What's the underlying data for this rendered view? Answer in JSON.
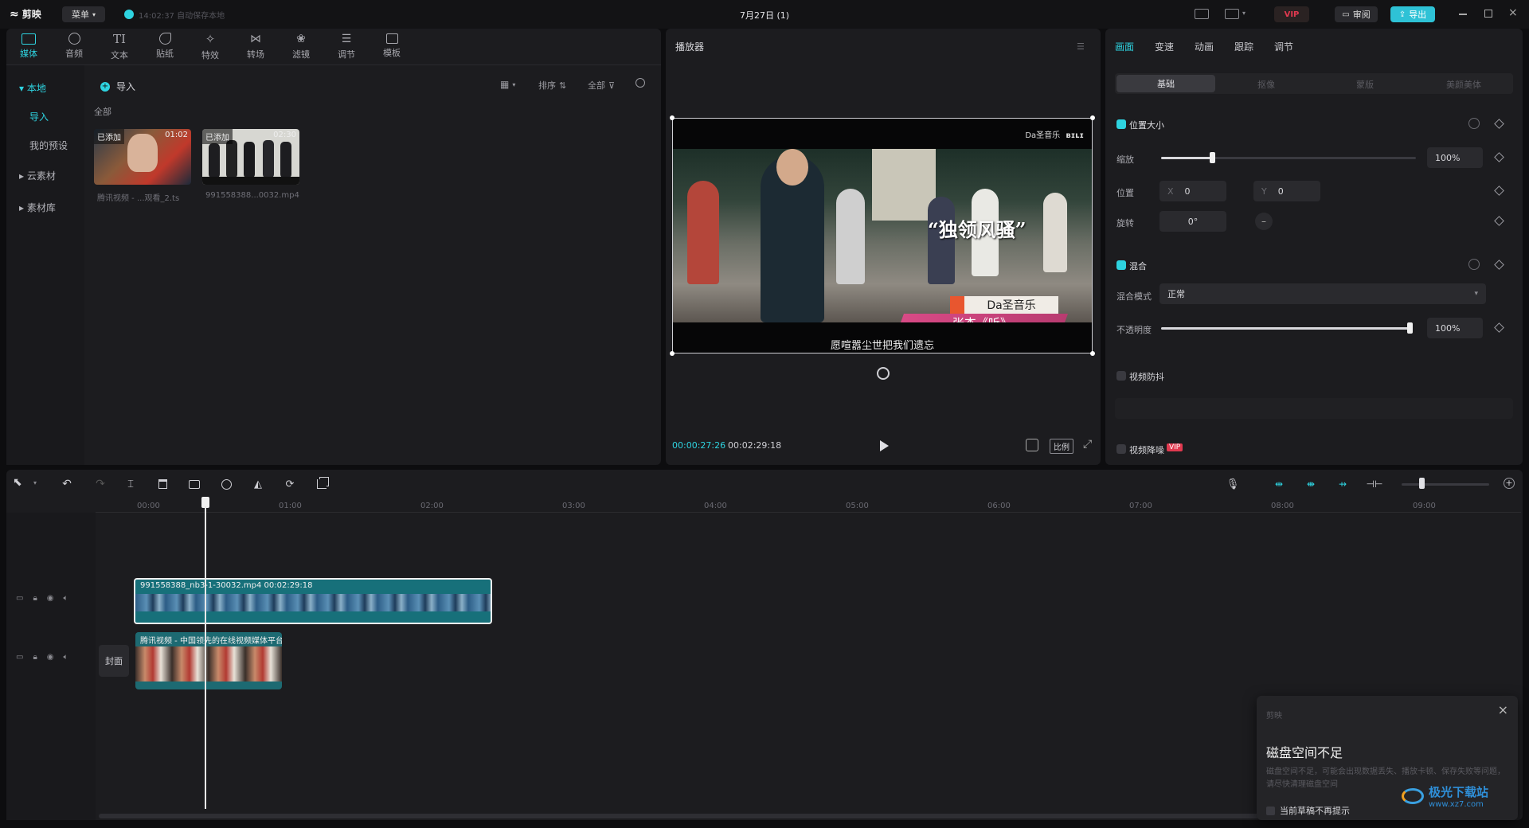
{
  "topbar": {
    "app_name": "剪映",
    "menu_label": "菜单",
    "autosave_text": "14:02:37 自动保存本地",
    "project_title": "7月27日 (1)",
    "vip_label": "VIP",
    "review_label": "审阅",
    "export_label": "导出"
  },
  "media_toolbar": {
    "tools": [
      "媒体",
      "音频",
      "文本",
      "贴纸",
      "特效",
      "转场",
      "滤镜",
      "调节",
      "模板"
    ]
  },
  "media_sidebar": {
    "items": [
      "本地",
      "导入",
      "我的预设",
      "云素材",
      "素材库"
    ]
  },
  "media_content": {
    "import_label": "导入",
    "sort_label": "排序",
    "filter_label": "全部",
    "section_label": "全部",
    "clips": [
      {
        "badge": "已添加",
        "duration": "01:02",
        "name": "腾讯视频 - ...观看_2.ts"
      },
      {
        "badge": "已添加",
        "duration": "02:30",
        "name": "991558388...0032.mp4"
      }
    ]
  },
  "player": {
    "title": "播放器",
    "watermark": "Da圣音乐",
    "caption_big": "“独领风骚”",
    "name_tag_top": "Da圣音乐",
    "name_tag_bottom": "张杰《听》",
    "subtitle": "愿喧嚣尘世把我们遗忘",
    "current_time": "00:00:27:26",
    "total_time": "00:02:29:18",
    "ratio_label": "比例"
  },
  "inspector": {
    "tabs": [
      "画面",
      "变速",
      "动画",
      "跟踪",
      "调节"
    ],
    "subtabs": [
      "基础",
      "抠像",
      "蒙版",
      "美颜美体"
    ],
    "position_size": {
      "title": "位置大小",
      "scale_label": "缩放",
      "scale_value": "100%",
      "scale_level": 0.2,
      "position_label": "位置",
      "x_label": "X",
      "x_value": "0",
      "y_label": "Y",
      "y_value": "0",
      "rotate_label": "旋转",
      "rotate_value": "0°"
    },
    "blend": {
      "title": "混合",
      "mode_label": "混合模式",
      "mode_value": "正常",
      "opacity_label": "不透明度",
      "opacity_value": "100%",
      "opacity_level": 1.0
    },
    "stabilize_label": "视频防抖",
    "denoise_label": "视频降噪",
    "denoise_badge": "VIP"
  },
  "timeline": {
    "ticks": [
      "00:00",
      "01:00",
      "02:00",
      "03:00",
      "04:00",
      "05:00",
      "06:00",
      "07:00",
      "08:00",
      "09:00"
    ],
    "main_clip_label": "991558388_nb3-1-30032.mp4  00:02:29:18",
    "second_clip_label": "腾讯视频 - 中国领先的在线视频媒体平台",
    "cover_label": "封面"
  },
  "toast": {
    "header": "剪映",
    "title": "磁盘空间不足",
    "body": "磁盘空间不足，可能会出现数据丢失、播放卡顿、保存失败等问题，请尽快清理磁盘空间",
    "checkbox_label": "当前草稿不再提示"
  },
  "watermark_site": {
    "name": "极光下载站",
    "url": "www.xz7.com"
  },
  "colors": {
    "accent": "#2ed3e0",
    "panel": "#1c1c1f",
    "background": "#0d0d0f",
    "clip_main": "#17707a",
    "vip_red": "#e0394f"
  }
}
